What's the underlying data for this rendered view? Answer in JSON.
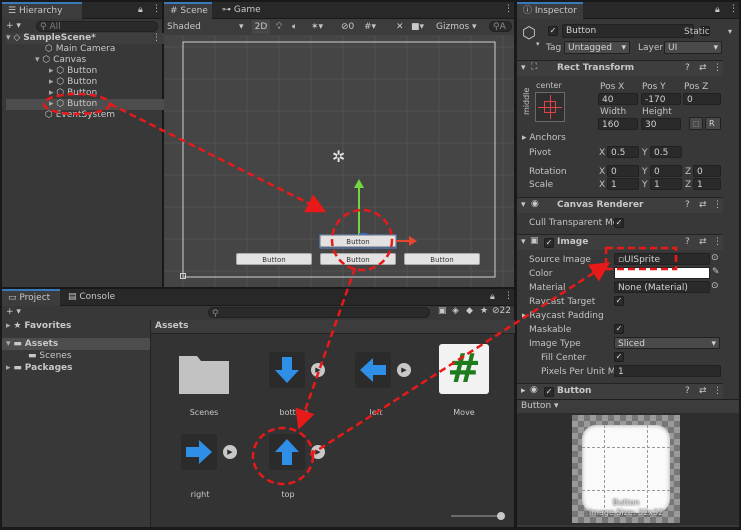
{
  "hierarchy": {
    "tab_label": "Hierarchy",
    "search_placeholder": "All",
    "add_label": "+ ▾",
    "items": [
      {
        "label": "SampleScene*"
      },
      {
        "label": "Main Camera"
      },
      {
        "label": "Canvas"
      },
      {
        "label": "Button"
      },
      {
        "label": "Button"
      },
      {
        "label": "Button"
      },
      {
        "label": "Button"
      },
      {
        "label": "EventSystem"
      }
    ]
  },
  "scene": {
    "tabs": [
      {
        "label": "Scene"
      },
      {
        "label": "Game"
      }
    ],
    "shading": "Shaded",
    "mode_2d": "2D",
    "hidden_count": "0",
    "gizmos": "Gizmos",
    "search_placeholder": "A",
    "canvas_buttons": [
      {
        "label": "Button"
      },
      {
        "label": "Button"
      },
      {
        "label": "Button"
      },
      {
        "label": "Button"
      }
    ]
  },
  "project": {
    "tabs": [
      {
        "label": "Project"
      },
      {
        "label": "Console"
      }
    ],
    "add_label": "+ ▾",
    "badge_count": "22",
    "favorites": "Favorites",
    "assets_folder": "Assets",
    "scenes_folder": "Scenes",
    "packages_folder": "Packages",
    "breadcrumb": "Assets",
    "assets": [
      {
        "label": "Scenes",
        "icon": "folder-icon"
      },
      {
        "label": "bottom",
        "icon": "arrow-down-icon"
      },
      {
        "label": "left",
        "icon": "arrow-left-icon"
      },
      {
        "label": "Move",
        "icon": "hash-script-icon"
      },
      {
        "label": "right",
        "icon": "arrow-right-icon"
      },
      {
        "label": "top",
        "icon": "arrow-up-icon"
      }
    ]
  },
  "inspector": {
    "tab_label": "Inspector",
    "object_name": "Button",
    "static_label": "Static",
    "tag_label": "Tag",
    "tag_value": "Untagged",
    "layer_label": "Layer",
    "layer_value": "UI",
    "rect_transform": {
      "title": "Rect Transform",
      "anchor_h": "center",
      "anchor_v": "middle",
      "pos_x_label": "Pos X",
      "pos_y_label": "Pos Y",
      "pos_z_label": "Pos Z",
      "pos_x": "40",
      "pos_y": "-170",
      "pos_z": "0",
      "width_label": "Width",
      "height_label": "Height",
      "width": "160",
      "height": "30",
      "r_label": "R",
      "anchors_label": "Anchors",
      "pivot_label": "Pivot",
      "pivot_x": "0.5",
      "pivot_y": "0.5",
      "rotation_label": "Rotation",
      "rot_x": "0",
      "rot_y": "0",
      "rot_z": "0",
      "scale_label": "Scale",
      "scale_x": "1",
      "scale_y": "1",
      "scale_z": "1",
      "x": "X",
      "y": "Y",
      "z": "Z"
    },
    "canvas_renderer": {
      "title": "Canvas Renderer",
      "cull_label": "Cull Transparent Mes"
    },
    "image": {
      "title": "Image",
      "source_label": "Source Image",
      "source_value": "UISprite",
      "color_label": "Color",
      "color_value": "#ffffff",
      "material_label": "Material",
      "material_value": "None (Material)",
      "raycast_target_label": "Raycast Target",
      "raycast_padding_label": "Raycast Padding",
      "maskable_label": "Maskable",
      "image_type_label": "Image Type",
      "image_type_value": "Sliced",
      "fill_center_label": "Fill Center",
      "ppu_label": "Pixels Per Unit Mul",
      "ppu_value": "1"
    },
    "button_component": {
      "title": "Button"
    },
    "preview": {
      "header": "Button ▾",
      "caption": "Button",
      "size_label": "Image Size: 32x32"
    }
  },
  "colors": {
    "accent": "#3a79bb",
    "selection": "#4d4d4d",
    "annotation": "#e81919"
  }
}
